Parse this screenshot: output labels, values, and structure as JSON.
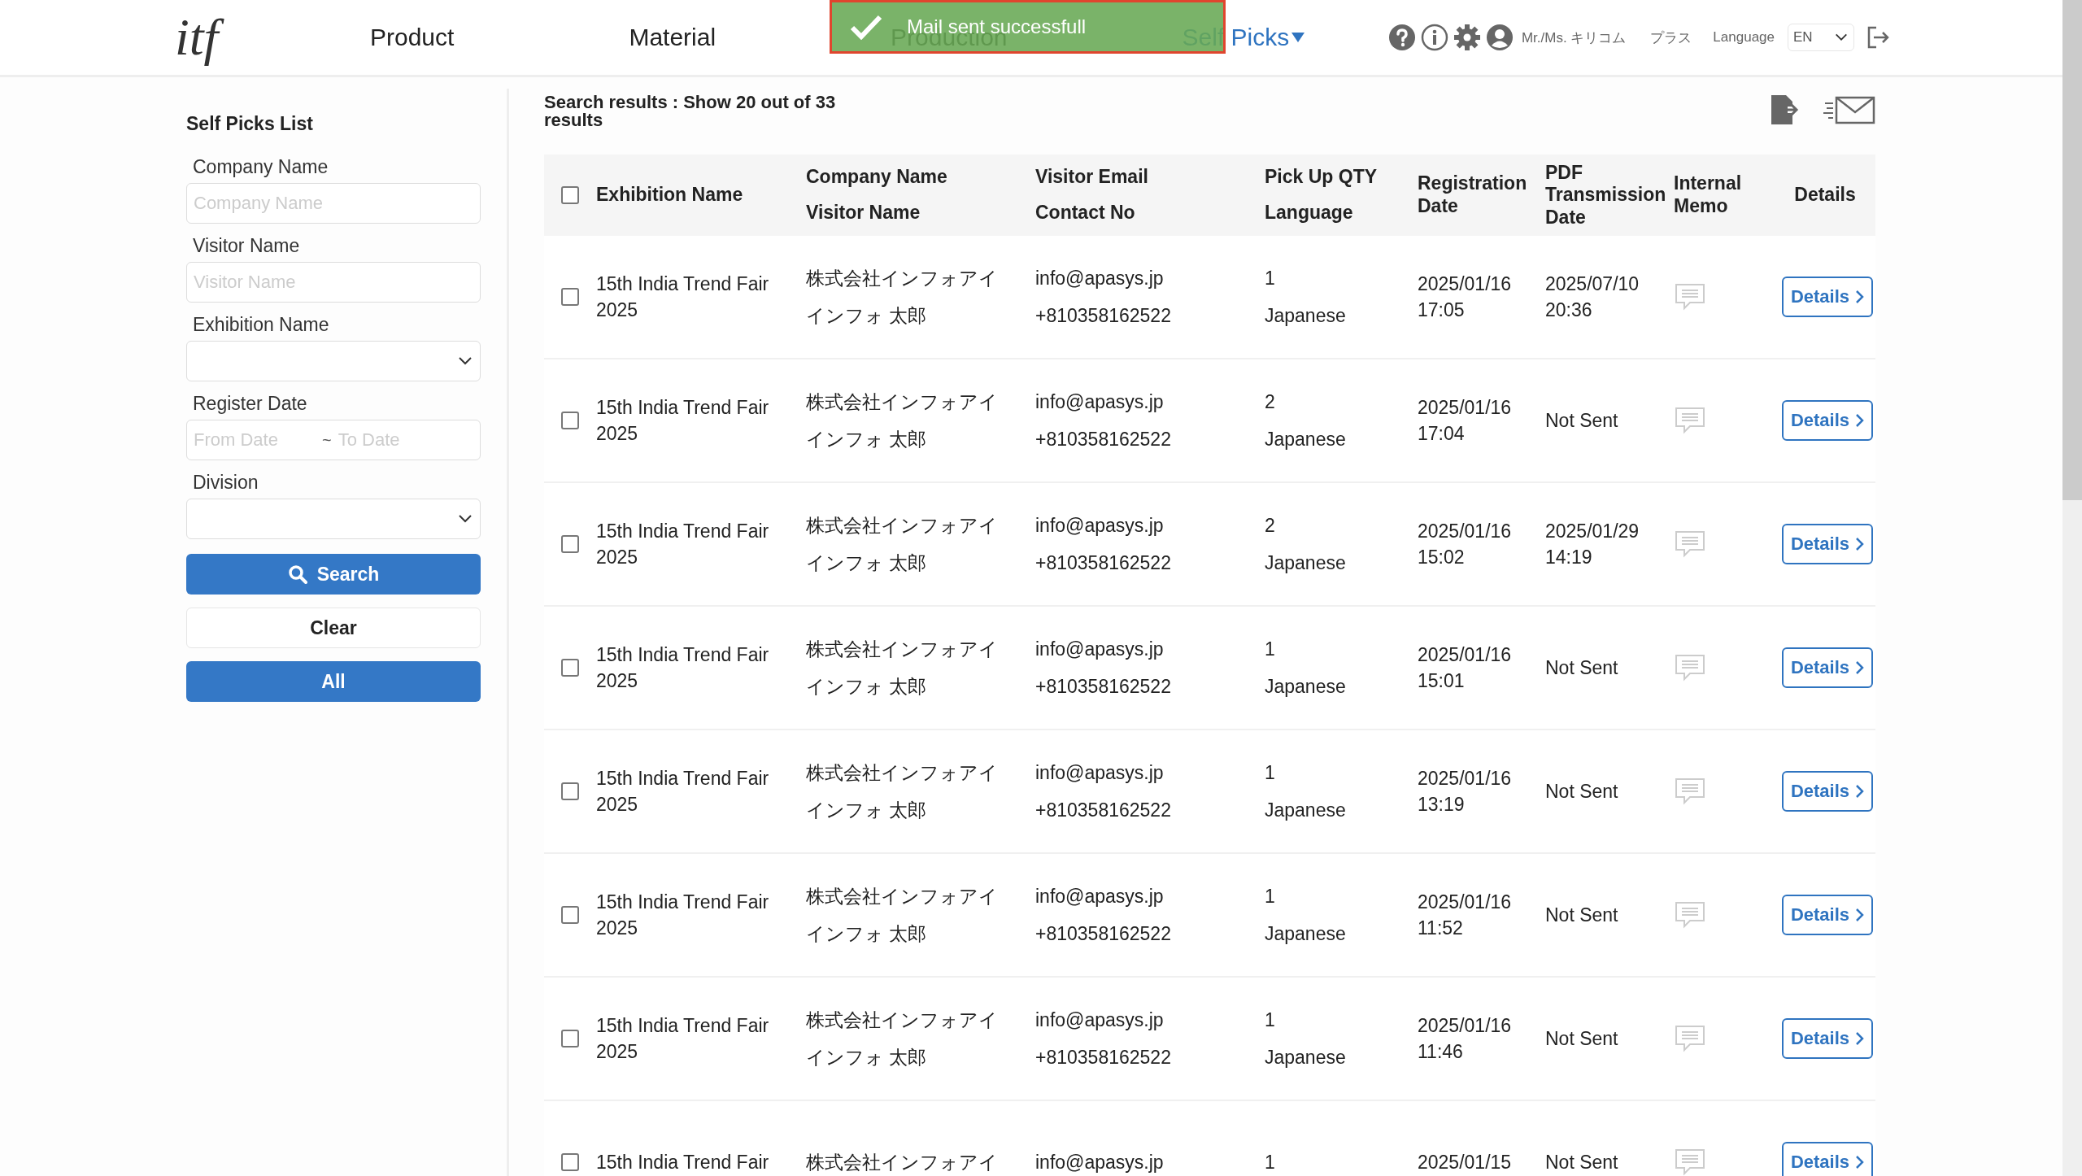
{
  "header": {
    "logo": "itf",
    "nav": [
      {
        "label": "Product",
        "selected": false,
        "has_menu": false
      },
      {
        "label": "Material",
        "selected": false,
        "has_menu": false
      },
      {
        "label": "Production",
        "selected": false,
        "has_menu": false
      },
      {
        "label": "Self Picks",
        "selected": true,
        "has_menu": true
      }
    ],
    "user": "Mr./Ms. キリコム",
    "company": "プラス",
    "language_label": "Language",
    "language": "EN"
  },
  "toast": {
    "message": "Mail sent successfull"
  },
  "sidebar": {
    "title": "Self Picks List",
    "filters": [
      {
        "kind": "text",
        "label": "Company Name",
        "placeholder": "Company Name"
      },
      {
        "kind": "text",
        "label": "Visitor Name",
        "placeholder": "Visitor Name"
      },
      {
        "kind": "select",
        "label": "Exhibition Name"
      },
      {
        "kind": "daterange",
        "label": "Register Date",
        "placeholder_from": "From Date",
        "separator": "~",
        "placeholder_to": "To Date"
      },
      {
        "kind": "select",
        "label": "Division"
      }
    ],
    "buttons": [
      {
        "kind": "search",
        "label": "Search"
      },
      {
        "kind": "secondary",
        "label": "Clear"
      },
      {
        "kind": "primary",
        "label": "All"
      }
    ]
  },
  "results": {
    "summary": "Search results : Show 20 out of 33 results",
    "select_all": {
      "checked": false
    },
    "columns": [
      {
        "labels": [
          "Exhibition Name"
        ]
      },
      {
        "labels": [
          "Company Name",
          "Visitor Name"
        ]
      },
      {
        "labels": [
          "Visitor Email",
          "Contact No"
        ]
      },
      {
        "labels": [
          "Pick Up QTY",
          "Language"
        ]
      },
      {
        "labels": [
          "Registration Date"
        ]
      },
      {
        "labels": [
          "PDF Transmission Date"
        ]
      },
      {
        "labels": [
          "Internal Memo"
        ]
      },
      {
        "labels": [
          "Details"
        ]
      }
    ],
    "rows": [
      {
        "checked": false,
        "exhibition": "15th India Trend Fair 2025",
        "company": "株式会社インフォアイ",
        "visitor_name": "インフォ 太郎",
        "email": "info@apasys.jp",
        "contact": "+810358162522",
        "qty": "1",
        "language": "Japanese",
        "registration_date": "2025/01/16 17:05",
        "pdf_date": "2025/07/10 20:36",
        "details": "Details"
      },
      {
        "checked": false,
        "exhibition": "15th India Trend Fair 2025",
        "company": "株式会社インフォアイ",
        "visitor_name": "インフォ 太郎",
        "email": "info@apasys.jp",
        "contact": "+810358162522",
        "qty": "2",
        "language": "Japanese",
        "registration_date": "2025/01/16 17:04",
        "pdf_date": "Not Sent",
        "details": "Details"
      },
      {
        "checked": false,
        "exhibition": "15th India Trend Fair 2025",
        "company": "株式会社インフォアイ",
        "visitor_name": "インフォ 太郎",
        "email": "info@apasys.jp",
        "contact": "+810358162522",
        "qty": "2",
        "language": "Japanese",
        "registration_date": "2025/01/16 15:02",
        "pdf_date": "2025/01/29 14:19",
        "details": "Details"
      },
      {
        "checked": false,
        "exhibition": "15th India Trend Fair 2025",
        "company": "株式会社インフォアイ",
        "visitor_name": "インフォ 太郎",
        "email": "info@apasys.jp",
        "contact": "+810358162522",
        "qty": "1",
        "language": "Japanese",
        "registration_date": "2025/01/16 15:01",
        "pdf_date": "Not Sent",
        "details": "Details"
      },
      {
        "checked": false,
        "exhibition": "15th India Trend Fair 2025",
        "company": "株式会社インフォアイ",
        "visitor_name": "インフォ 太郎",
        "email": "info@apasys.jp",
        "contact": "+810358162522",
        "qty": "1",
        "language": "Japanese",
        "registration_date": "2025/01/16 13:19",
        "pdf_date": "Not Sent",
        "details": "Details"
      },
      {
        "checked": false,
        "exhibition": "15th India Trend Fair 2025",
        "company": "株式会社インフォアイ",
        "visitor_name": "インフォ 太郎",
        "email": "info@apasys.jp",
        "contact": "+810358162522",
        "qty": "1",
        "language": "Japanese",
        "registration_date": "2025/01/16 11:52",
        "pdf_date": "Not Sent",
        "details": "Details"
      },
      {
        "checked": false,
        "exhibition": "15th India Trend Fair 2025",
        "company": "株式会社インフォアイ",
        "visitor_name": "インフォ 太郎",
        "email": "info@apasys.jp",
        "contact": "+810358162522",
        "qty": "1",
        "language": "Japanese",
        "registration_date": "2025/01/16 11:46",
        "pdf_date": "Not Sent",
        "details": "Details"
      },
      {
        "checked": false,
        "exhibition": "15th India Trend Fair",
        "company": "株式会社インフォアイ",
        "email": "info@apasys.jp",
        "qty": "1",
        "registration_date": "2025/01/15",
        "pdf_date": "Not Sent",
        "details": "Details"
      }
    ]
  }
}
